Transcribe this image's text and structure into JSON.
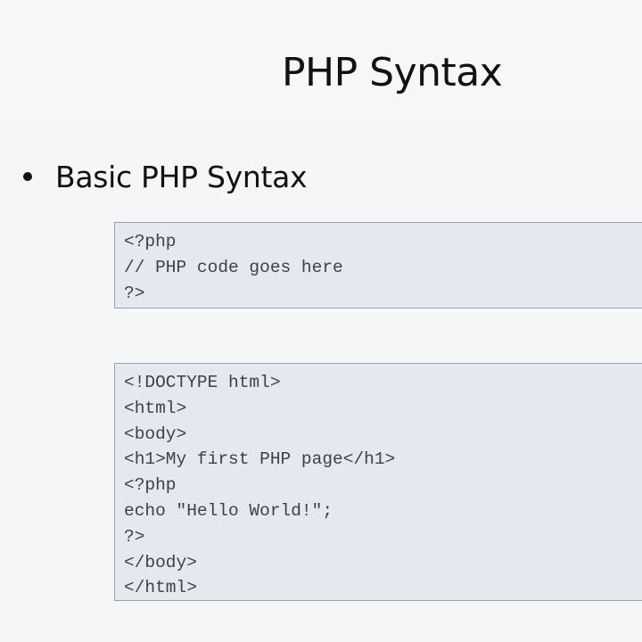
{
  "slide": {
    "title": "PHP Syntax",
    "bullet": "Basic PHP Syntax"
  },
  "code_blocks": [
    {
      "lines": [
        "<?php",
        "// PHP code goes here",
        "?>"
      ]
    },
    {
      "lines": [
        "<!DOCTYPE html>",
        "<html>",
        "<body>",
        "<h1>My first PHP page</h1>",
        "<?php",
        "echo \"Hello World!\";",
        "?>",
        "</body>",
        "</html>"
      ]
    }
  ]
}
